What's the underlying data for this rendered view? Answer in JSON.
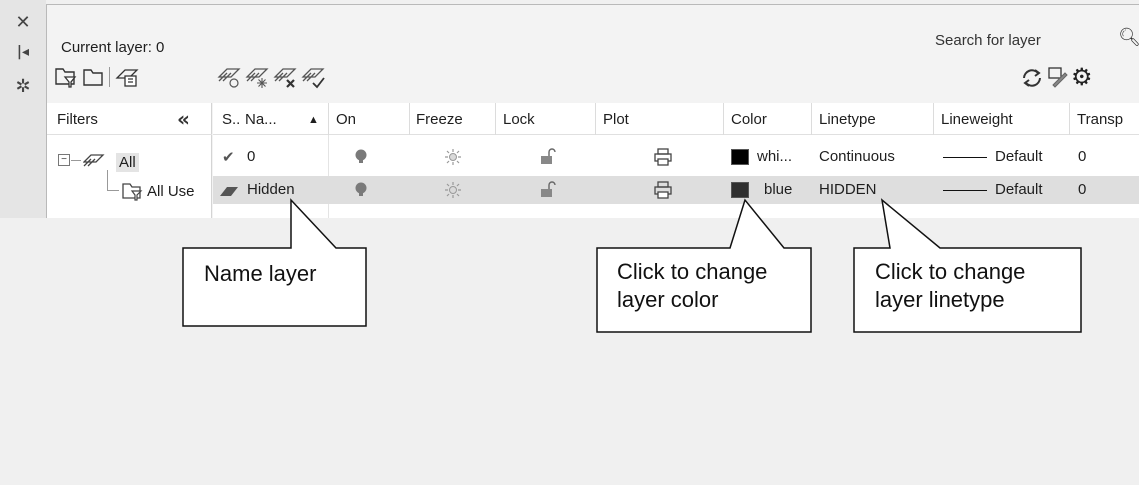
{
  "window": {
    "close_icon": "close-icon",
    "pin_icon": "auto-hide-icon",
    "properties_icon": "gear-icon"
  },
  "header": {
    "current_layer": "Current layer: 0",
    "search_placeholder": "Search for layer"
  },
  "filters": {
    "label": "Filters",
    "collapse": "«",
    "tree": [
      {
        "label": "All",
        "expanded": true
      },
      {
        "label": "All Use"
      }
    ]
  },
  "columns": [
    {
      "key": "status",
      "label": "S.."
    },
    {
      "key": "name",
      "label": "Na...",
      "sort": "▲"
    },
    {
      "key": "on",
      "label": "On"
    },
    {
      "key": "freeze",
      "label": "Freeze"
    },
    {
      "key": "lock",
      "label": "Lock"
    },
    {
      "key": "plot",
      "label": "Plot"
    },
    {
      "key": "color",
      "label": "Color"
    },
    {
      "key": "linetype",
      "label": "Linetype"
    },
    {
      "key": "lineweight",
      "label": "Lineweight"
    },
    {
      "key": "transparency",
      "label": "Transp"
    }
  ],
  "layers": [
    {
      "status": "current",
      "name": "0",
      "color_name": "whi...",
      "color_hex": "#000000",
      "linetype": "Continuous",
      "lineweight": "Default",
      "transparency": "0",
      "selected": false
    },
    {
      "status": "layer",
      "name": "Hidden",
      "color_name": "blue",
      "color_hex": "#2f2f2f",
      "linetype": "HIDDEN",
      "lineweight": "Default",
      "transparency": "0",
      "selected": true
    }
  ],
  "callouts": {
    "name_layer": "Name layer",
    "change_color": [
      "Click to change",
      "layer color"
    ],
    "change_linetype": [
      "Click to change",
      "layer linetype"
    ]
  },
  "colors": {
    "accent": "#2f2f2f",
    "selected_row": "#dedede",
    "panel_bg": "#f3f3f3"
  }
}
